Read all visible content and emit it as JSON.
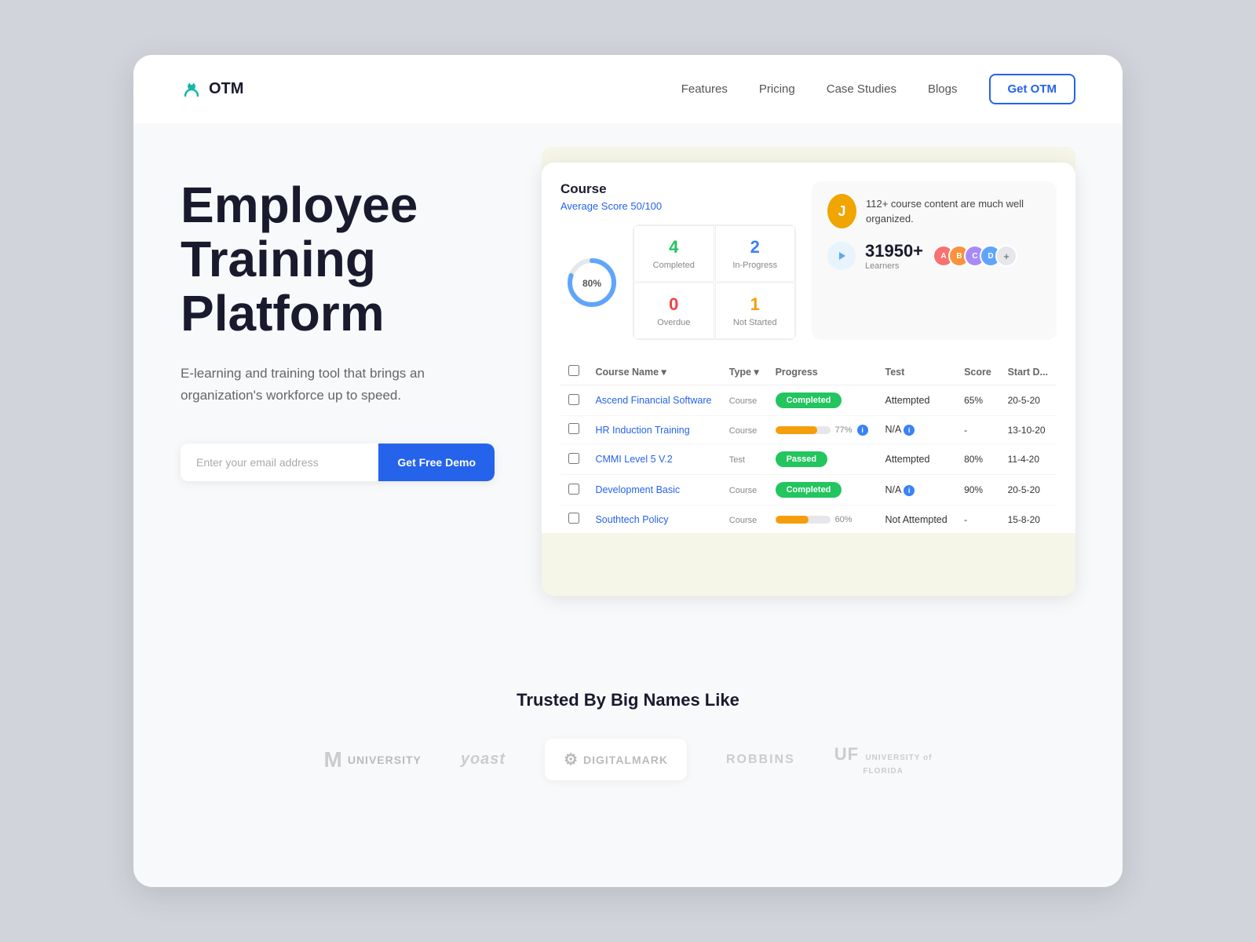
{
  "nav": {
    "logo_text": "OTM",
    "links": [
      "Features",
      "Pricing",
      "Case Studies",
      "Blogs"
    ],
    "cta_label": "Get OTM"
  },
  "hero": {
    "title": "Employee Training Platform",
    "subtitle": "E-learning and training tool that brings an organization's workforce up to speed.",
    "email_placeholder": "Enter your email address",
    "demo_btn": "Get Free Demo"
  },
  "dashboard": {
    "course_title": "Course",
    "avg_score": "Average Score 50/100",
    "circle_pct": "80%",
    "stats": [
      {
        "num": "4",
        "label": "Completed",
        "color": "green"
      },
      {
        "num": "2",
        "label": "In-Progress",
        "color": "blue"
      },
      {
        "num": "0",
        "label": "Overdue",
        "color": "red"
      },
      {
        "num": "1",
        "label": "Not Started",
        "color": "orange"
      }
    ],
    "testimonial": {
      "text": "112+ course content are much well organized.",
      "avatar_initial": "J"
    },
    "learners": {
      "count": "31950+",
      "label": "Learners"
    },
    "table": {
      "headers": [
        "Course Name",
        "Type",
        "Progress",
        "Test",
        "Score",
        "Start D..."
      ],
      "rows": [
        {
          "name": "Ascend Financial Software",
          "type": "Course",
          "progress": "Completed",
          "progress_type": "badge-green",
          "test": "Attempted",
          "score": "65%",
          "date": "20-5-20"
        },
        {
          "name": "HR Induction Training",
          "type": "Course",
          "progress": "77%",
          "progress_type": "bar",
          "test": "N/A",
          "score": "-",
          "date": "13-10-20"
        },
        {
          "name": "CMMI Level 5 V.2",
          "type": "Test",
          "progress": "Passed",
          "progress_type": "badge-green",
          "test": "Attempted",
          "score": "80%",
          "date": "11-4-20"
        },
        {
          "name": "Development Basic",
          "type": "Course",
          "progress": "Completed",
          "progress_type": "badge-green",
          "test": "N/A",
          "score": "90%",
          "date": "20-5-20"
        },
        {
          "name": "Southtech Policy",
          "type": "Course",
          "progress": "60%",
          "progress_type": "bar",
          "test": "Not Attempted",
          "score": "-",
          "date": "15-8-20"
        }
      ]
    }
  },
  "trusted": {
    "title": "Trusted By Big Names Like",
    "logos": [
      {
        "name": "University",
        "type": "m-university"
      },
      {
        "name": "yoast",
        "type": "yoast"
      },
      {
        "name": "DIGITALMARK",
        "type": "digitalmark"
      },
      {
        "name": "ROBBINS",
        "type": "robbins"
      },
      {
        "name": "University of Florida",
        "type": "uf"
      }
    ]
  }
}
